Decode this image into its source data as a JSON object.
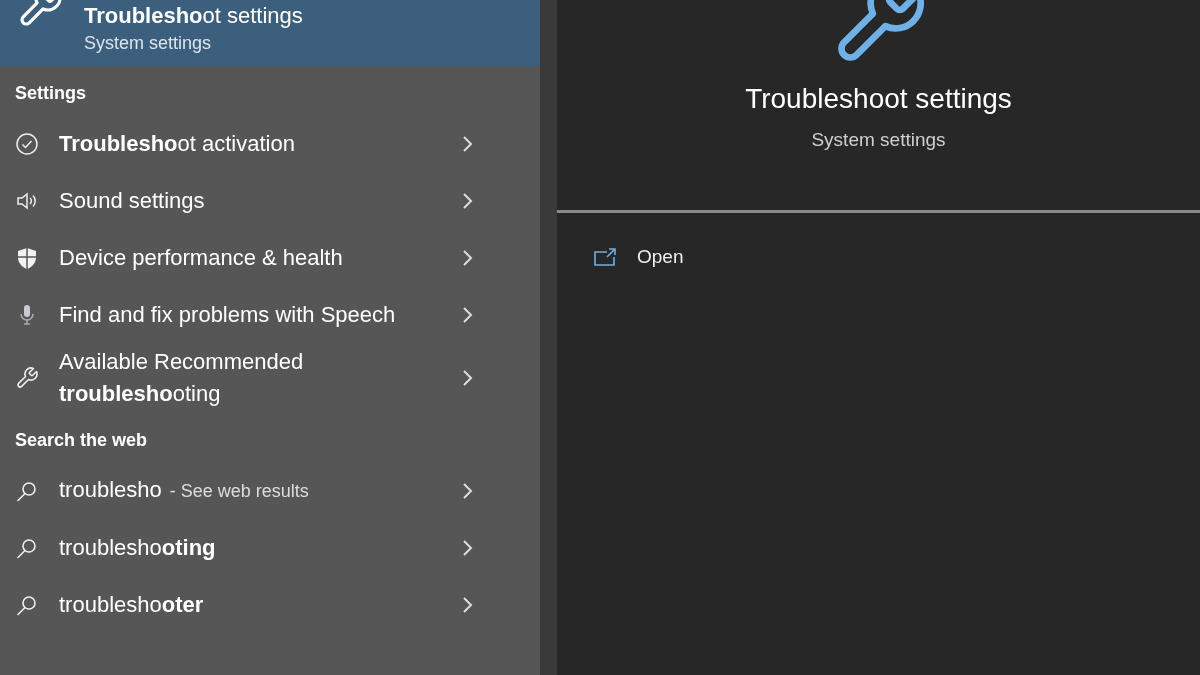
{
  "top_result": {
    "title": "**Troublesho**ot settings",
    "subtitle": "System settings",
    "selected": true
  },
  "sections": [
    {
      "heading": "Settings",
      "items": [
        {
          "kind": "check",
          "text": "**Troublesho**ot activation"
        },
        {
          "kind": "sound",
          "text": "Sound settings"
        },
        {
          "kind": "shield",
          "text": "Device performance & health"
        },
        {
          "kind": "mic",
          "text": "Find and fix problems with Speech"
        },
        {
          "kind": "wrench",
          "text": "Available Recommended **troublesho**oting"
        }
      ]
    },
    {
      "heading": "Search the web",
      "items": [
        {
          "kind": "search",
          "text": "troublesho",
          "suffix": "- See web results"
        },
        {
          "kind": "search",
          "text": "troublesho**oting**"
        },
        {
          "kind": "search",
          "text": "troublesho**oter**"
        }
      ]
    }
  ],
  "detail": {
    "title": "Troubleshoot settings",
    "subtitle": "System settings",
    "actions": [
      {
        "label": "Open"
      }
    ]
  }
}
